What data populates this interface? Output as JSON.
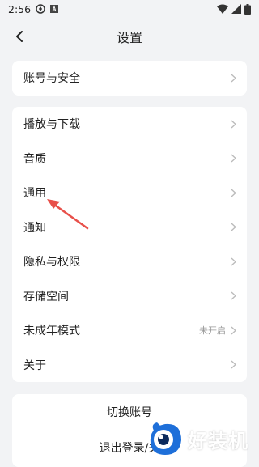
{
  "status_bar": {
    "time": "2:56"
  },
  "header": {
    "title": "设置"
  },
  "section_account": {
    "items": [
      {
        "label": "账号与安全"
      }
    ]
  },
  "section_main": {
    "items": [
      {
        "label": "播放与下载"
      },
      {
        "label": "音质"
      },
      {
        "label": "通用"
      },
      {
        "label": "通知"
      },
      {
        "label": "隐私与权限"
      },
      {
        "label": "存储空间"
      },
      {
        "label": "未成年模式",
        "value": "未开启"
      },
      {
        "label": "关于"
      }
    ]
  },
  "section_actions": {
    "switch_account": "切换账号",
    "logout": "退出登录/关"
  },
  "watermark": {
    "text": "好装机"
  },
  "colors": {
    "annotation_arrow": "#e8504a",
    "background": "#f2f3f5",
    "card": "#ffffff"
  }
}
